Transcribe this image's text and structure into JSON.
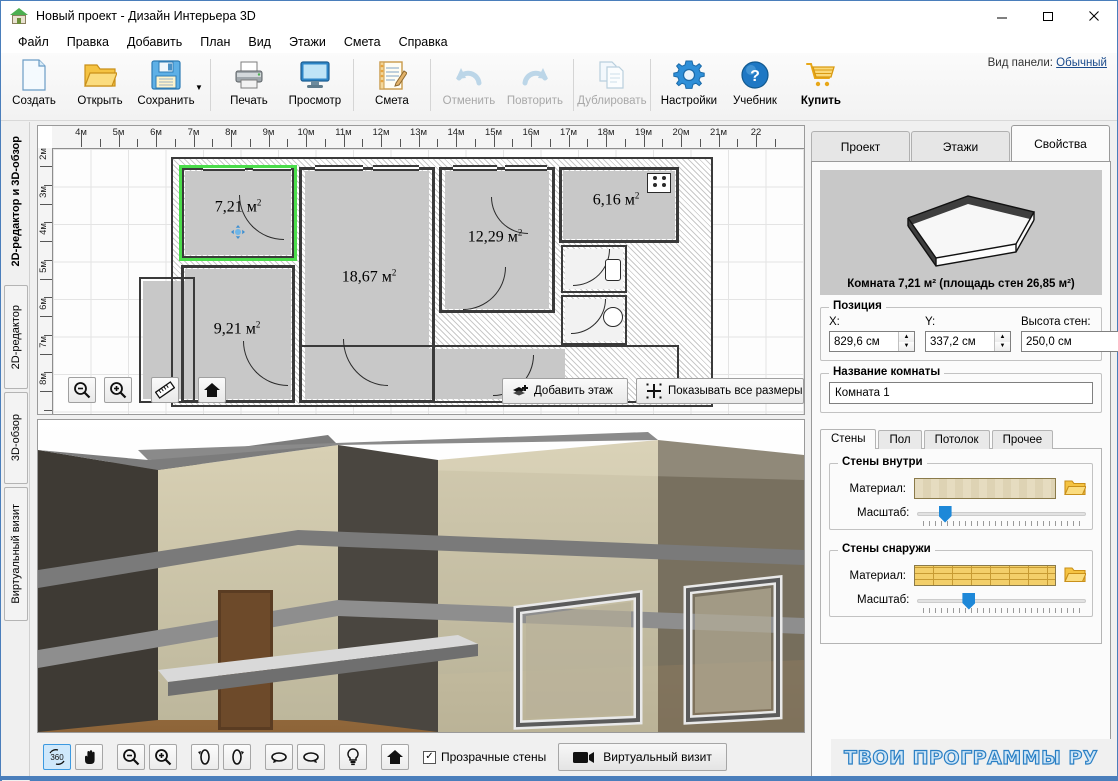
{
  "window": {
    "title": "Новый проект - Дизайн Интерьера 3D",
    "icon": "house-icon",
    "minimize": "minimize-icon",
    "maximize": "maximize-icon",
    "close": "close-icon"
  },
  "menu": {
    "items": [
      {
        "label": "Файл"
      },
      {
        "label": "Правка"
      },
      {
        "label": "Добавить"
      },
      {
        "label": "План"
      },
      {
        "label": "Вид"
      },
      {
        "label": "Этажи"
      },
      {
        "label": "Смета"
      },
      {
        "label": "Справка"
      }
    ]
  },
  "toolbar": {
    "buttons": [
      {
        "label": "Создать",
        "icon": "new-document-icon",
        "disabled": false
      },
      {
        "label": "Открыть",
        "icon": "open-folder-icon",
        "disabled": false
      },
      {
        "label": "Сохранить",
        "icon": "save-floppy-icon",
        "disabled": false
      },
      {
        "label": "Печать",
        "icon": "printer-icon",
        "disabled": false
      },
      {
        "label": "Просмотр",
        "icon": "monitor-preview-icon",
        "disabled": false
      },
      {
        "label": "Смета",
        "icon": "estimate-notepad-icon",
        "disabled": false
      },
      {
        "label": "Отменить",
        "icon": "undo-arrow-icon",
        "disabled": true
      },
      {
        "label": "Повторить",
        "icon": "redo-arrow-icon",
        "disabled": true
      },
      {
        "label": "Дублировать",
        "icon": "duplicate-pages-icon",
        "disabled": true
      },
      {
        "label": "Настройки",
        "icon": "gear-icon",
        "disabled": false
      },
      {
        "label": "Учебник",
        "icon": "question-help-icon",
        "disabled": false
      },
      {
        "label": "Купить",
        "icon": "shopping-cart-icon",
        "disabled": false
      }
    ],
    "panel_view_label": "Вид панели:",
    "panel_view_value": "Обычный"
  },
  "left_tabs": {
    "items": [
      {
        "label": "2D-редактор и 3D-обзор",
        "selected": true
      },
      {
        "label": "2D-редактор",
        "selected": false
      },
      {
        "label": "3D-обзор",
        "selected": false
      },
      {
        "label": "Виртуальный визит",
        "selected": false
      }
    ]
  },
  "plan": {
    "ruler_unit": "м",
    "h_labels": [
      "4м",
      "5м",
      "6м",
      "7м",
      "8м",
      "9м",
      "10м",
      "11м",
      "12м",
      "13м",
      "14м",
      "15м",
      "16м",
      "17м",
      "18м",
      "19м",
      "20м",
      "21м",
      "22"
    ],
    "v_labels": [
      "2м",
      "3м",
      "4м",
      "5м",
      "6м",
      "7м",
      "8м"
    ],
    "rooms": [
      {
        "area": "7,21 м",
        "sup": "2",
        "selected": true
      },
      {
        "area": "18,67 м",
        "sup": "2",
        "selected": false
      },
      {
        "area": "9,21 м",
        "sup": "2",
        "selected": false
      },
      {
        "area": "12,29 м",
        "sup": "2",
        "selected": false
      },
      {
        "area": "6,16 м",
        "sup": "2",
        "selected": false
      }
    ],
    "tools": [
      {
        "name": "zoom-out-icon",
        "label": ""
      },
      {
        "name": "zoom-in-icon",
        "label": ""
      },
      {
        "name": "ruler-icon",
        "label": ""
      },
      {
        "name": "home-icon",
        "label": ""
      }
    ],
    "add_floor_button": "Добавить этаж",
    "show_all_sizes_button": "Показывать все размеры"
  },
  "view3d_toolbar": {
    "buttons": [
      {
        "name": "rotate-360-icon",
        "active": true
      },
      {
        "name": "pan-hand-icon",
        "active": false
      },
      {
        "name": "zoom-out-icon",
        "active": false
      },
      {
        "name": "zoom-in-icon",
        "active": false
      },
      {
        "name": "rotate-left-icon",
        "active": false
      },
      {
        "name": "rotate-right-icon",
        "active": false
      },
      {
        "name": "orbit-left-icon",
        "active": false
      },
      {
        "name": "orbit-right-icon",
        "active": false
      },
      {
        "name": "lightbulb-icon",
        "active": false
      },
      {
        "name": "home-icon",
        "active": false
      }
    ],
    "transparent_walls_label": "Прозрачные стены",
    "transparent_walls_checked": true,
    "virtual_visit_label": "Виртуальный визит",
    "virtual_visit_icon": "video-camera-icon"
  },
  "right_panel": {
    "tabs": [
      {
        "label": "Проект",
        "selected": false
      },
      {
        "label": "Этажи",
        "selected": false
      },
      {
        "label": "Свойства",
        "selected": true
      }
    ],
    "preview_caption": "Комната 7,21 м²  (площадь стен 26,85 м²)",
    "position": {
      "legend": "Позиция",
      "x_label": "X:",
      "x_value": "829,6 см",
      "y_label": "Y:",
      "y_value": "337,2 см",
      "height_label": "Высота стен:",
      "height_value": "250,0 см"
    },
    "room_name": {
      "legend": "Название комнаты",
      "value": "Комната 1",
      "placeholder": "Комната 1"
    },
    "subtabs": [
      {
        "label": "Стены",
        "selected": true
      },
      {
        "label": "Пол",
        "selected": false
      },
      {
        "label": "Потолок",
        "selected": false
      },
      {
        "label": "Прочее",
        "selected": false
      }
    ],
    "walls_inside": {
      "legend": "Стены внутри",
      "material_label": "Материал:",
      "material_swatch": "beige-damask-wallpaper",
      "scale_label": "Масштаб:",
      "scale_pos_pct": 16,
      "browse_icon": "open-folder-icon"
    },
    "walls_outside": {
      "legend": "Стены снаружи",
      "material_label": "Материал:",
      "material_swatch": "yellow-brick",
      "scale_label": "Масштаб:",
      "scale_pos_pct": 30,
      "browse_icon": "open-folder-icon"
    }
  },
  "watermark": {
    "text": "ТВОИ ПРОГРАММЫ РУ"
  },
  "colors": {
    "accent": "#4a7ebb",
    "selection_green": "#4bdd4b",
    "slider_blue": "#1e88d8",
    "room_fill": "#c8c8c8",
    "wall_stroke": "#3a3a3a"
  }
}
